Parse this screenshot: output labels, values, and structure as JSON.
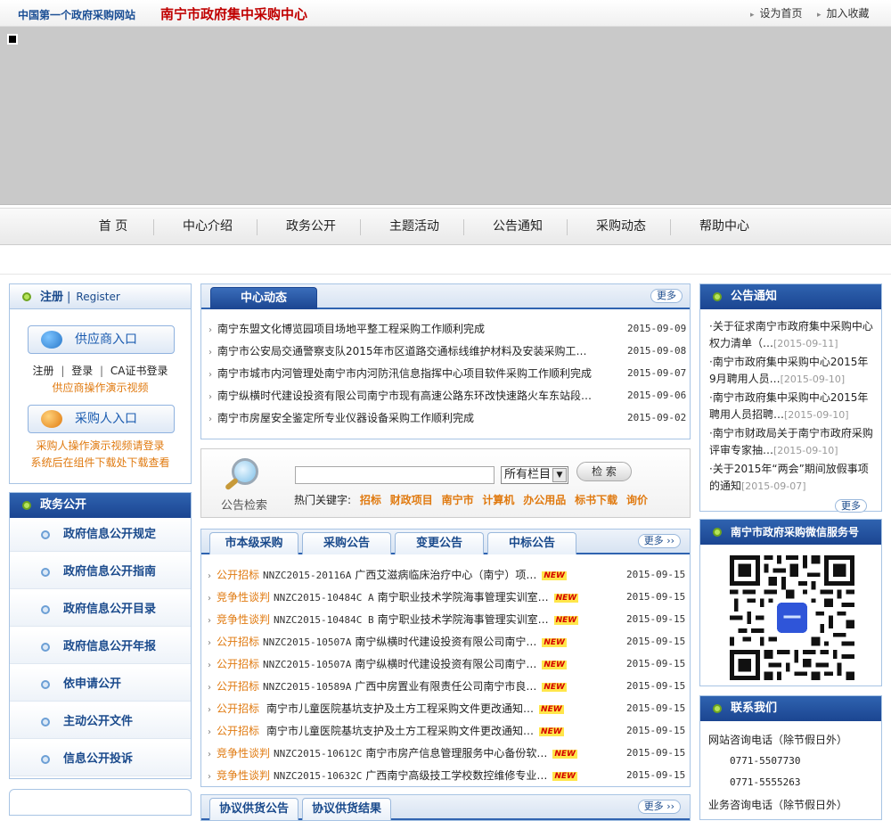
{
  "topbar": {
    "site_name": "中国第一个政府采购网站",
    "center_name": "南宁市政府集中采购中心",
    "set_home": "设为首页",
    "add_fav": "加入收藏"
  },
  "nav": {
    "items": [
      "首 页",
      "中心介绍",
      "政务公开",
      "主题活动",
      "公告通知",
      "采购动态",
      "帮助中心"
    ]
  },
  "login": {
    "title": "注册",
    "title_en": "Register",
    "supplier_btn": "供应商入口",
    "register": "注册",
    "login": "登录",
    "ca_login": "CA证书登录",
    "supplier_video": "供应商操作演示视频",
    "buyer_btn": "采购人入口",
    "buyer_note_1": "采购人操作演示视频请登录",
    "buyer_note_2": "系统后在组件下载处下载查看"
  },
  "gov_affairs": {
    "title": "政务公开",
    "items": [
      "政府信息公开规定",
      "政府信息公开指南",
      "政府信息公开目录",
      "政府信息公开年报",
      "依申请公开",
      "主动公开文件",
      "信息公开投诉"
    ]
  },
  "center_news": {
    "tab": "中心动态",
    "more": "更多",
    "rows": [
      {
        "title": "南宁东盟文化博览园项目场地平整工程采购工作顺利完成",
        "date": "2015-09-09"
      },
      {
        "title": "南宁市公安局交通警察支队2015年市区道路交通标线维护材料及安装采购工…",
        "date": "2015-09-08"
      },
      {
        "title": "南宁市城市内河管理处南宁市内河防汛信息指挥中心项目软件采购工作顺利完成",
        "date": "2015-09-07"
      },
      {
        "title": "南宁纵横时代建设投资有限公司南宁市现有高速公路东环改快速路火车东站段…",
        "date": "2015-09-06"
      },
      {
        "title": "南宁市房屋安全鉴定所专业仪器设备采购工作顺利完成",
        "date": "2015-09-02"
      }
    ]
  },
  "search": {
    "label": "公告检索",
    "select_value": "所有栏目",
    "button": "检 索",
    "hot_label": "热门关键字:",
    "keywords": [
      "招标",
      "财政项目",
      "南宁市",
      "计算机",
      "办公用品",
      "标书下载",
      "询价"
    ]
  },
  "procurement": {
    "tabs": [
      "市本级采购",
      "采购公告",
      "变更公告",
      "中标公告"
    ],
    "more": "更多",
    "new_badge": "NEW",
    "rows": [
      {
        "cat": "公开招标",
        "code": "NNZC2015-20116A",
        "title": "广西艾滋病临床治疗中心（南宁）项…",
        "date": "2015-09-15"
      },
      {
        "cat": "竞争性谈判",
        "code": "NNZC2015-10484C A",
        "title": "南宁职业技术学院海事管理实训室…",
        "date": "2015-09-15"
      },
      {
        "cat": "竞争性谈判",
        "code": "NNZC2015-10484C B",
        "title": "南宁职业技术学院海事管理实训室…",
        "date": "2015-09-15"
      },
      {
        "cat": "公开招标",
        "code": "NNZC2015-10507A",
        "title": "南宁纵横时代建设投资有限公司南宁…",
        "date": "2015-09-15"
      },
      {
        "cat": "公开招标",
        "code": "NNZC2015-10507A",
        "title": "南宁纵横时代建设投资有限公司南宁…",
        "date": "2015-09-15"
      },
      {
        "cat": "公开招标",
        "code": "NNZC2015-10589A",
        "title": "广西中房置业有限责任公司南宁市良…",
        "date": "2015-09-15"
      },
      {
        "cat": "公开招标",
        "code": "",
        "title": "南宁市儿童医院基坑支护及土方工程采购文件更改通知…",
        "date": "2015-09-15"
      },
      {
        "cat": "公开招标",
        "code": "",
        "title": "南宁市儿童医院基坑支护及土方工程采购文件更改通知…",
        "date": "2015-09-15"
      },
      {
        "cat": "竞争性谈判",
        "code": "NNZC2015-10612C",
        "title": "南宁市房产信息管理服务中心备份软…",
        "date": "2015-09-15"
      },
      {
        "cat": "竞争性谈判",
        "code": "NNZC2015-10632C",
        "title": "广西南宁高级技工学校数控维修专业…",
        "date": "2015-09-15"
      }
    ]
  },
  "agreement": {
    "tabs": [
      "协议供货公告",
      "协议供货结果"
    ],
    "more": "更多"
  },
  "notices": {
    "title": "公告通知",
    "more": "更多",
    "items": [
      {
        "text": "·关于征求南宁市政府集中采购中心权力清单（…",
        "date": "[2015-09-11]"
      },
      {
        "text": "·南宁市政府集中采购中心2015年9月聘用人员…",
        "date": "[2015-09-10]"
      },
      {
        "text": "·南宁市政府集中采购中心2015年聘用人员招聘…",
        "date": "[2015-09-10]"
      },
      {
        "text": "·南宁市财政局关于南宁市政府采购评审专家抽…",
        "date": "[2015-09-10]"
      },
      {
        "text": "·关于2015年“两会”期间放假事项的通知",
        "date": "[2015-09-07]"
      }
    ]
  },
  "wechat": {
    "title": "南宁市政府采购微信服务号"
  },
  "contact": {
    "title": "联系我们",
    "consult_label": "网站咨询电话（除节假日外）",
    "phone_1": "0771-5507730",
    "phone_2": "0771-5555263",
    "business_label": "业务咨询电话（除节假日外）"
  }
}
